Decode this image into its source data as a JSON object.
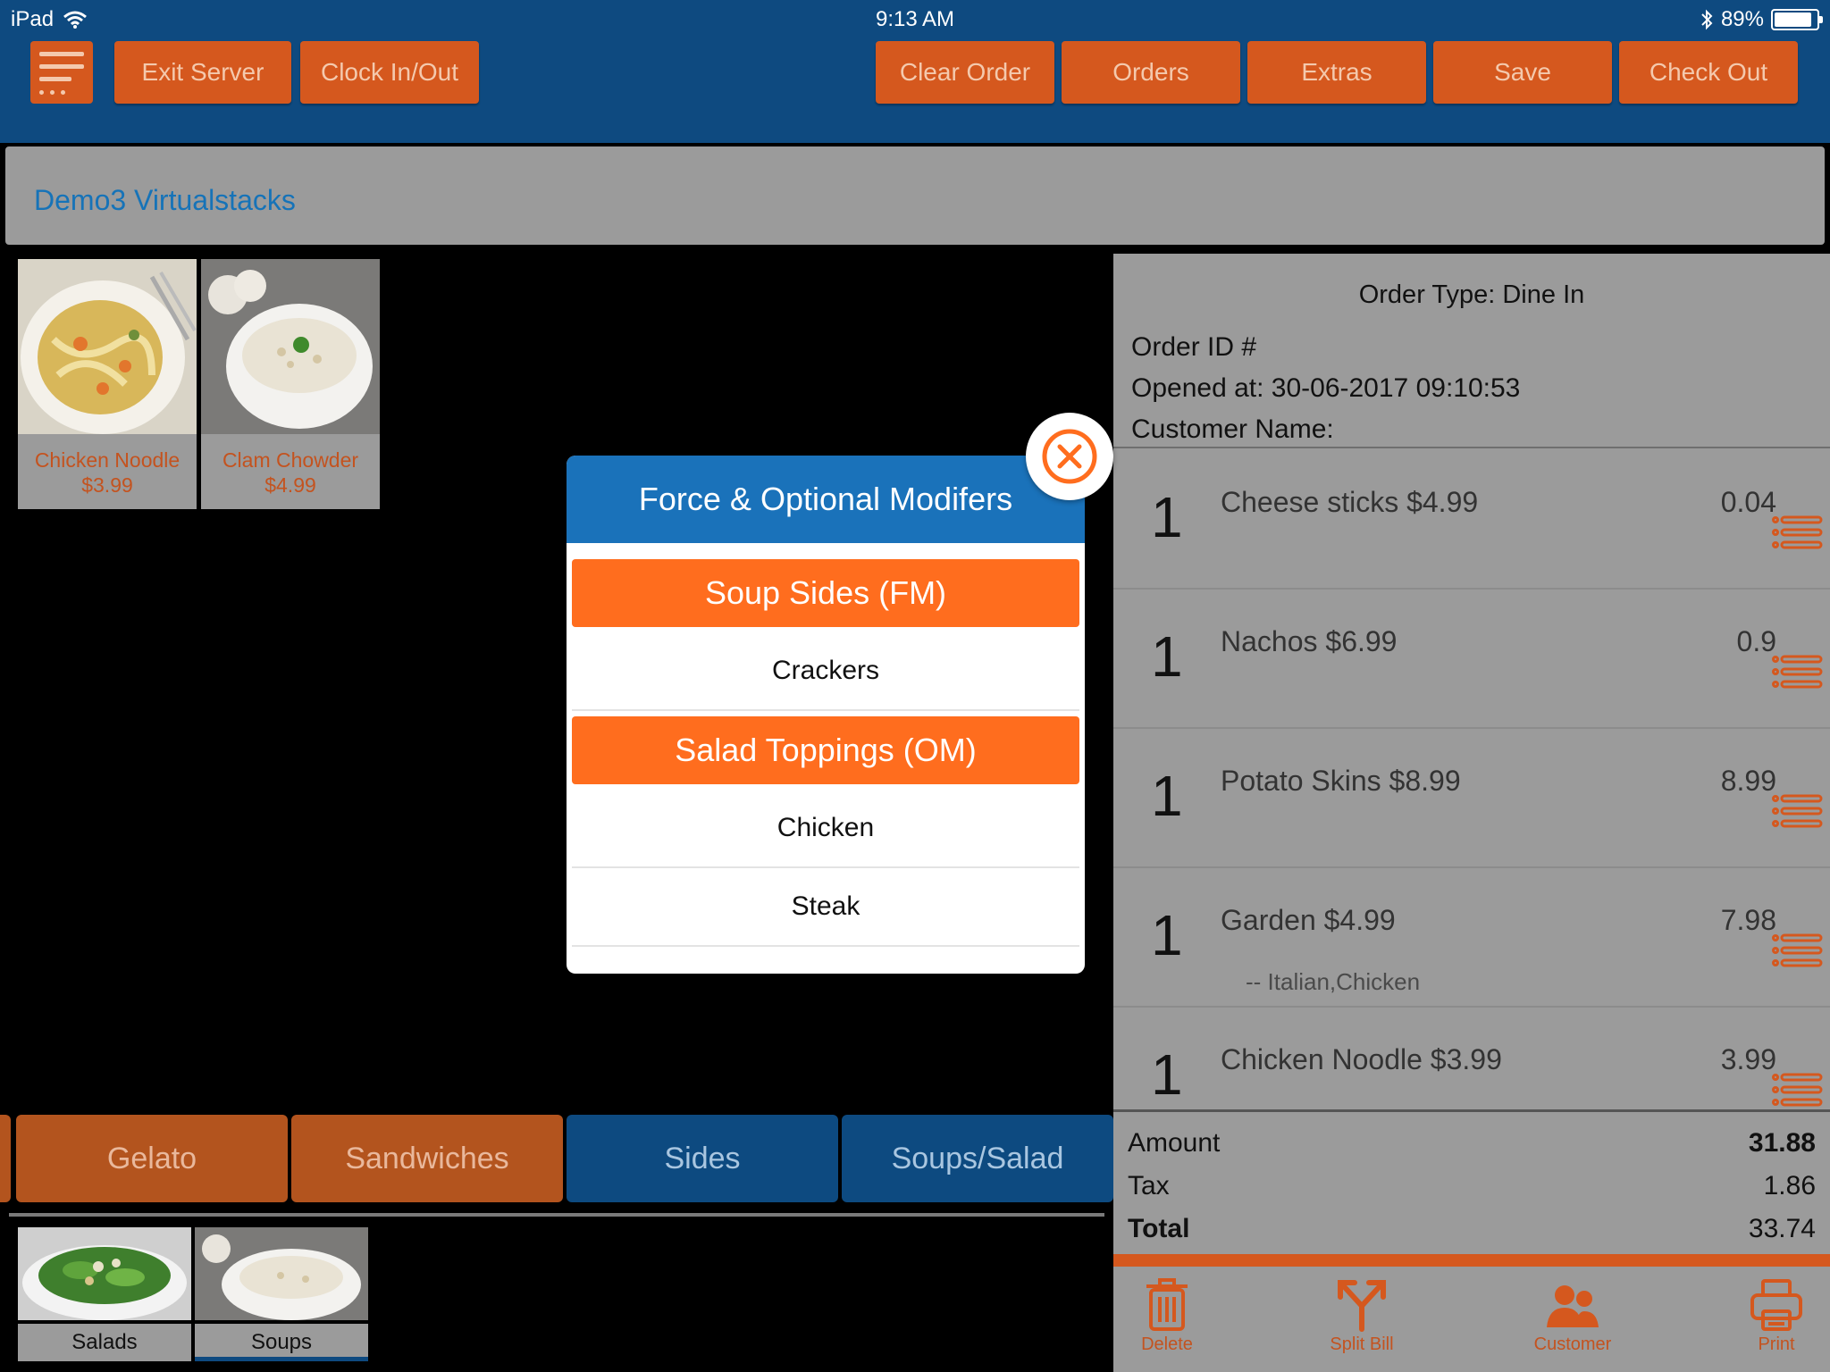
{
  "status": {
    "device": "iPad",
    "time": "9:13 AM",
    "battery": "89%"
  },
  "toolbar": {
    "exit_server": "Exit Server",
    "clock": "Clock In/Out",
    "clear_order": "Clear Order",
    "orders": "Orders",
    "extras": "Extras",
    "save": "Save",
    "check_out": "Check Out"
  },
  "location": {
    "name": "Demo3 Virtualstacks"
  },
  "items": [
    {
      "name": "Chicken Noodle",
      "price": "$3.99"
    },
    {
      "name": "Clam Chowder",
      "price": "$4.99"
    }
  ],
  "order": {
    "type_label": "Order Type: Dine In",
    "id_label": "Order ID #",
    "opened_label": "Opened at: 30-06-2017 09:10:53",
    "customer_label": "Customer Name:",
    "lines": [
      {
        "qty": "1",
        "desc": "Cheese sticks $4.99",
        "amount": "0.04",
        "modifiers": ""
      },
      {
        "qty": "1",
        "desc": "Nachos $6.99",
        "amount": "0.9",
        "modifiers": ""
      },
      {
        "qty": "1",
        "desc": "Potato Skins $8.99",
        "amount": "8.99",
        "modifiers": ""
      },
      {
        "qty": "1",
        "desc": "Garden $4.99",
        "amount": "7.98",
        "modifiers": "-- Italian,Chicken"
      },
      {
        "qty": "1",
        "desc": "Chicken Noodle $3.99",
        "amount": "3.99",
        "modifiers": ""
      }
    ],
    "amount_label": "Amount",
    "amount": "31.88",
    "tax_label": "Tax",
    "tax": "1.86",
    "total_label": "Total",
    "total": "33.74"
  },
  "bottom_actions": {
    "delete": "Delete",
    "split_bill": "Split Bill",
    "customer": "Customer",
    "print": "Print"
  },
  "categories": [
    {
      "label": "Gelato",
      "state": "normal"
    },
    {
      "label": "Sandwiches",
      "state": "normal"
    },
    {
      "label": "Sides",
      "state": "selected"
    },
    {
      "label": "Soups/Salad",
      "state": "selected"
    }
  ],
  "subcategories": [
    {
      "label": "Salads",
      "active": false
    },
    {
      "label": "Soups",
      "active": true
    }
  ],
  "modal": {
    "title": "Force & Optional Modifers",
    "groups": [
      {
        "header": "Soup Sides (FM)",
        "options": [
          "Crackers"
        ]
      },
      {
        "header": "Salad Toppings (OM)",
        "options": [
          "Chicken",
          "Steak"
        ]
      }
    ]
  },
  "colors": {
    "toolbar_bg": "#0e4a80",
    "accent_orange": "#d5581e",
    "modal_header": "#1a72ba",
    "modifier_orange": "#ff6d1e"
  }
}
